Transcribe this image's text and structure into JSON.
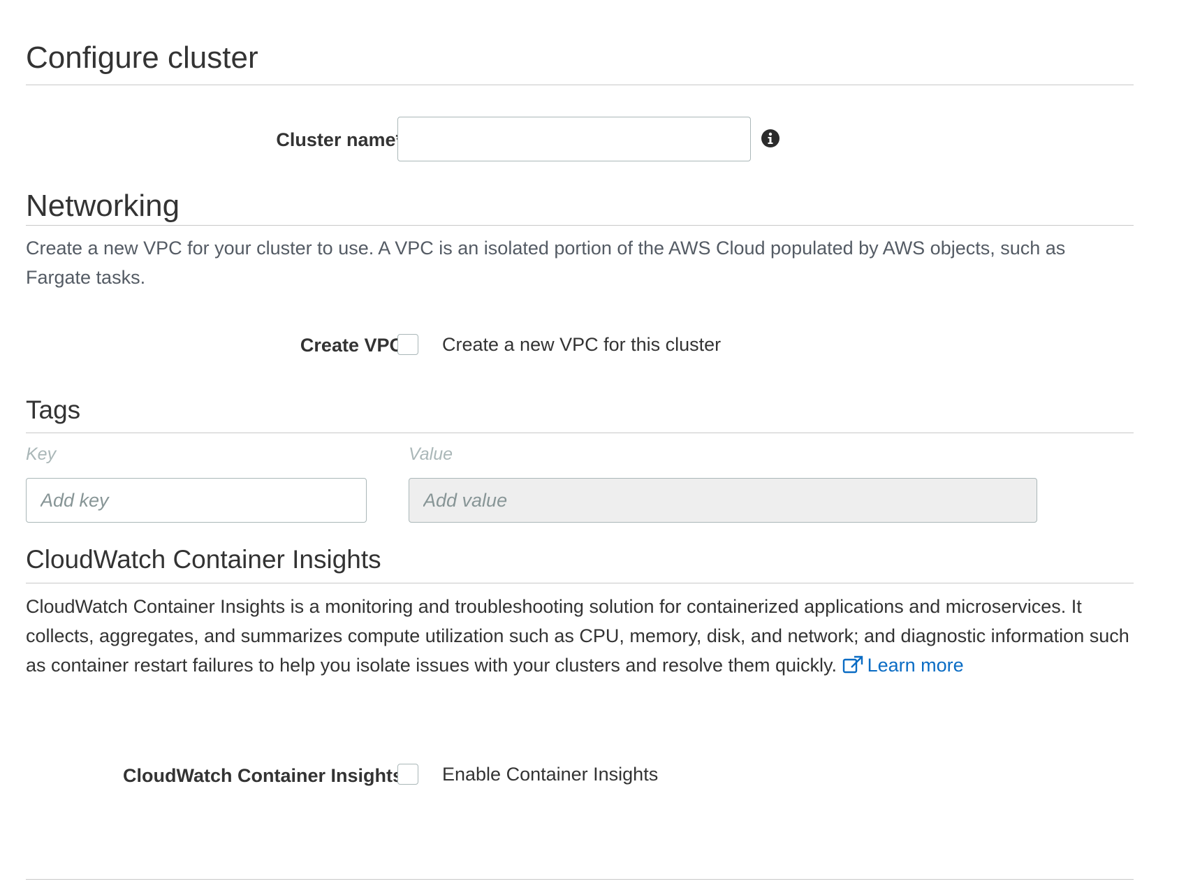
{
  "configure": {
    "title": "Configure cluster",
    "cluster_name_label": "Cluster name*",
    "cluster_name_value": "",
    "cluster_name_placeholder": "",
    "info_icon": "info-circle-icon"
  },
  "networking": {
    "title": "Networking",
    "description": "Create a new VPC for your cluster to use. A VPC is an isolated portion of the AWS Cloud populated by AWS objects, such as Fargate tasks.",
    "create_vpc_label": "Create VPC",
    "create_vpc_checkbox_label": "Create a new VPC for this cluster",
    "create_vpc_checked": false
  },
  "tags": {
    "title": "Tags",
    "key_caption": "Key",
    "value_caption": "Value",
    "key_placeholder": "Add key",
    "value_placeholder": "Add value"
  },
  "insights": {
    "title": "CloudWatch Container Insights",
    "description": "CloudWatch Container Insights is a monitoring and troubleshooting solution for containerized applications and microservices. It collects, aggregates, and summarizes compute utilization such as CPU, memory, disk, and network; and diagnostic information such as container restart failures to help you isolate issues with your clusters and resolve them quickly.",
    "learn_more_label": "Learn more",
    "learn_more_icon": "external-link-icon",
    "row_label": "CloudWatch Container Insights",
    "checkbox_label": "Enable Container Insights",
    "enabled": false
  },
  "colors": {
    "link": "#0a6cc4",
    "rule": "#c8c8c8",
    "input_border": "#aab7b8",
    "disabled_bg": "#eeeeee"
  }
}
